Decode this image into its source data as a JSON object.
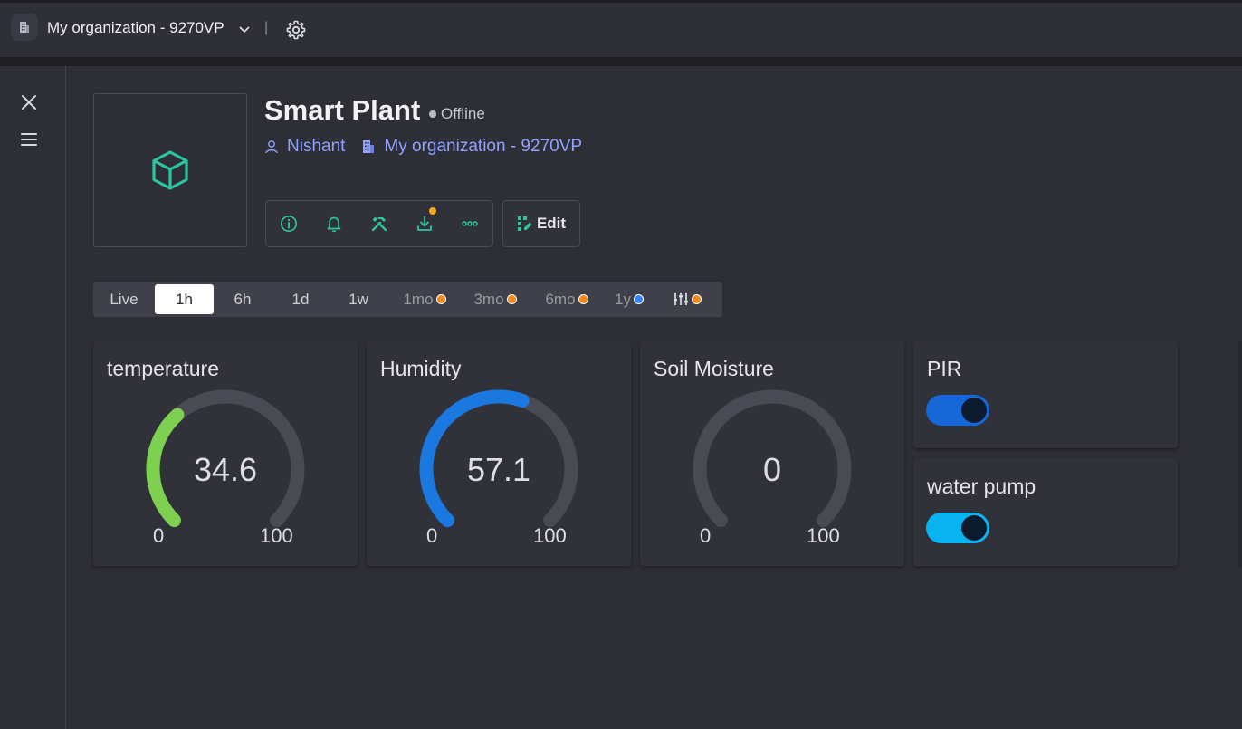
{
  "topbar": {
    "org_name": "My organization - 9270VP",
    "divider": "|",
    "icons": [
      "building-icon",
      "chevron-down-icon",
      "gear-icon"
    ]
  },
  "sidebar": {
    "icons": [
      "close-icon",
      "menu-icon"
    ]
  },
  "device": {
    "title": "Smart Plant",
    "status": "Offline",
    "owner": "Nishant",
    "organization": "My organization - 9270VP",
    "image_icon": "cube-icon"
  },
  "actions": {
    "icons": [
      "info-icon",
      "bell-icon",
      "tools-icon",
      "download-icon",
      "more-icon"
    ],
    "edit_label": "Edit"
  },
  "time_range": {
    "items": [
      {
        "label": "Live",
        "active": false
      },
      {
        "label": "1h",
        "active": true
      },
      {
        "label": "6h",
        "active": false
      },
      {
        "label": "1d",
        "active": false
      },
      {
        "label": "1w",
        "active": false
      },
      {
        "label": "1mo",
        "active": false,
        "badge_color": "#f28a1c"
      },
      {
        "label": "3mo",
        "active": false,
        "badge_color": "#f28a1c"
      },
      {
        "label": "6mo",
        "active": false,
        "badge_color": "#f28a1c"
      },
      {
        "label": "1y",
        "active": false,
        "badge_color": "#2f86ff"
      }
    ],
    "filter_icon": "sliders-icon",
    "filter_badge_color": "#f28a1c"
  },
  "widgets": {
    "temperature": {
      "title": "temperature",
      "value": "34.6",
      "min": "0",
      "max": "100",
      "fraction": 0.346,
      "color": "#7ed050"
    },
    "humidity": {
      "title": "Humidity",
      "value": "57.1",
      "min": "0",
      "max": "100",
      "fraction": 0.571,
      "color": "#1a78e0"
    },
    "soil": {
      "title": "Soil Moisture",
      "value": "0",
      "min": "0",
      "max": "100",
      "fraction": 0,
      "color": "#1a78e0"
    },
    "pir": {
      "title": "PIR",
      "on": true,
      "color": "#1667d8"
    },
    "pump": {
      "title": "water pump",
      "on": true,
      "color": "#08b3f0"
    }
  },
  "colors": {
    "accent_green": "#2ec4a0",
    "link_blue": "#8ea2ff",
    "gauge_track": "#4a4a54"
  }
}
